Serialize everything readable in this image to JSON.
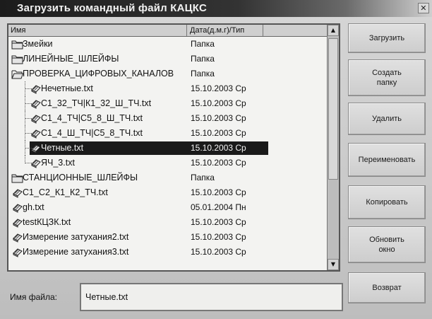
{
  "window": {
    "title": "Загрузить командный файл КАЦКС",
    "close_label": "✕"
  },
  "list": {
    "columns": {
      "name": "Имя",
      "date_type": "Дата(д.м.г)/Тип"
    },
    "rows": [
      {
        "name": "Змейки",
        "info": "Папка",
        "kind": "folder",
        "indent": 0,
        "selected": false
      },
      {
        "name": "ЛИНЕЙНЫЕ_ШЛЕЙФЫ",
        "info": "Папка",
        "kind": "folder",
        "indent": 0,
        "selected": false
      },
      {
        "name": "ПРОВЕРКА_ЦИФРОВЫХ_КАНАЛОВ",
        "info": "Папка",
        "kind": "folder-open",
        "indent": 0,
        "selected": false
      },
      {
        "name": "Нечетные.txt",
        "info": "15.10.2003 Ср",
        "kind": "file",
        "indent": 1,
        "selected": false
      },
      {
        "name": "С1_32_ТЧ|К1_32_Ш_ТЧ.txt",
        "info": "15.10.2003 Ср",
        "kind": "file",
        "indent": 1,
        "selected": false
      },
      {
        "name": "С1_4_ТЧ|С5_8_Ш_ТЧ.txt",
        "info": "15.10.2003 Ср",
        "kind": "file",
        "indent": 1,
        "selected": false
      },
      {
        "name": "С1_4_Ш_ТЧ|С5_8_ТЧ.txt",
        "info": "15.10.2003 Ср",
        "kind": "file",
        "indent": 1,
        "selected": false
      },
      {
        "name": "Четные.txt",
        "info": "15.10.2003 Ср",
        "kind": "file",
        "indent": 1,
        "selected": true
      },
      {
        "name": "ЯЧ_3.txt",
        "info": "15.10.2003 Ср",
        "kind": "file",
        "indent": 1,
        "selected": false
      },
      {
        "name": "СТАНЦИОННЫЕ_ШЛЕЙФЫ",
        "info": "Папка",
        "kind": "folder",
        "indent": 0,
        "selected": false
      },
      {
        "name": "С1_С2_К1_К2_ТЧ.txt",
        "info": "15.10.2003 Ср",
        "kind": "file",
        "indent": 0,
        "selected": false
      },
      {
        "name": "gh.txt",
        "info": "05.01.2004 Пн",
        "kind": "file",
        "indent": 0,
        "selected": false
      },
      {
        "name": "testКЦЗК.txt",
        "info": "15.10.2003 Ср",
        "kind": "file",
        "indent": 0,
        "selected": false
      },
      {
        "name": "Измерение затухания2.txt",
        "info": "15.10.2003 Ср",
        "kind": "file",
        "indent": 0,
        "selected": false
      },
      {
        "name": "Измерение затухания3.txt",
        "info": "15.10.2003 Ср",
        "kind": "file",
        "indent": 0,
        "selected": false
      }
    ]
  },
  "buttons": {
    "load": "Загрузить",
    "create_folder": "Создать папку",
    "delete": "Удалить",
    "rename": "Переименовать",
    "copy": "Копировать",
    "refresh": "Обновить окно",
    "back": "Возврат"
  },
  "filename": {
    "label": "Имя файла:",
    "value": "Четные.txt"
  },
  "icons": {
    "folder": "folder-icon",
    "folder_open": "folder-open-icon",
    "file": "document-icon",
    "close": "close-icon"
  }
}
